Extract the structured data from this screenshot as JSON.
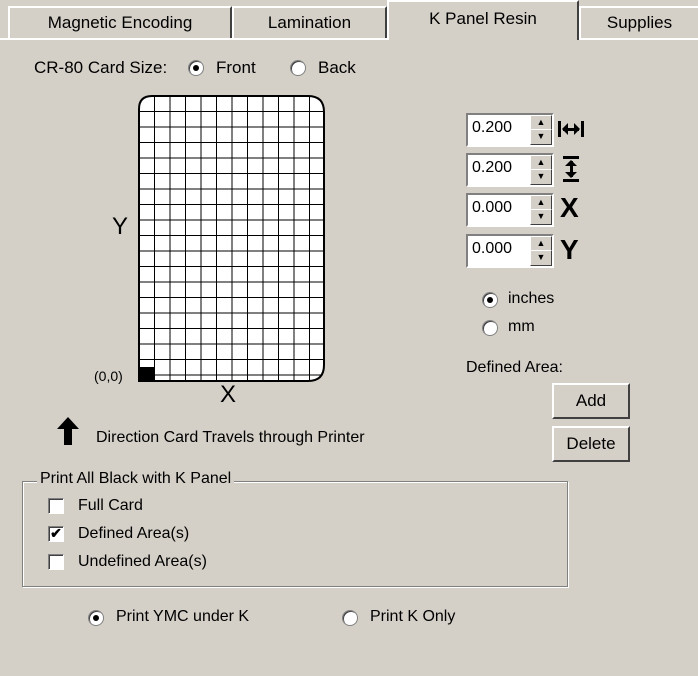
{
  "tabs": [
    {
      "label": "Magnetic Encoding"
    },
    {
      "label": "Lamination"
    },
    {
      "label": "K Panel Resin"
    },
    {
      "label": "Supplies"
    }
  ],
  "card_size": {
    "label": "CR-80 Card Size:",
    "options": [
      {
        "label": "Front",
        "selected": true
      },
      {
        "label": "Back",
        "selected": false
      }
    ]
  },
  "grid": {
    "y_label": "Y",
    "x_label": "X",
    "origin_label": "(0,0)"
  },
  "direction_text": "Direction Card Travels through Printer",
  "spinners": [
    {
      "value": "0.200",
      "icon": "width-arrows-icon"
    },
    {
      "value": "0.200",
      "icon": "height-arrows-icon"
    },
    {
      "value": "0.000",
      "icon": "x-icon",
      "symbol": "X"
    },
    {
      "value": "0.000",
      "icon": "y-icon",
      "symbol": "Y"
    }
  ],
  "units": [
    {
      "label": "inches",
      "selected": true
    },
    {
      "label": "mm",
      "selected": false
    }
  ],
  "defined_area": {
    "label": "Defined Area:",
    "add": "Add",
    "delete": "Delete"
  },
  "print_black": {
    "title": "Print All Black with K Panel",
    "options": [
      {
        "label": "Full Card",
        "checked": false
      },
      {
        "label": "Defined Area(s)",
        "checked": true
      },
      {
        "label": "Undefined Area(s)",
        "checked": false
      }
    ]
  },
  "print_mode": [
    {
      "label": "Print YMC under K",
      "selected": true
    },
    {
      "label": "Print K Only",
      "selected": false
    }
  ]
}
